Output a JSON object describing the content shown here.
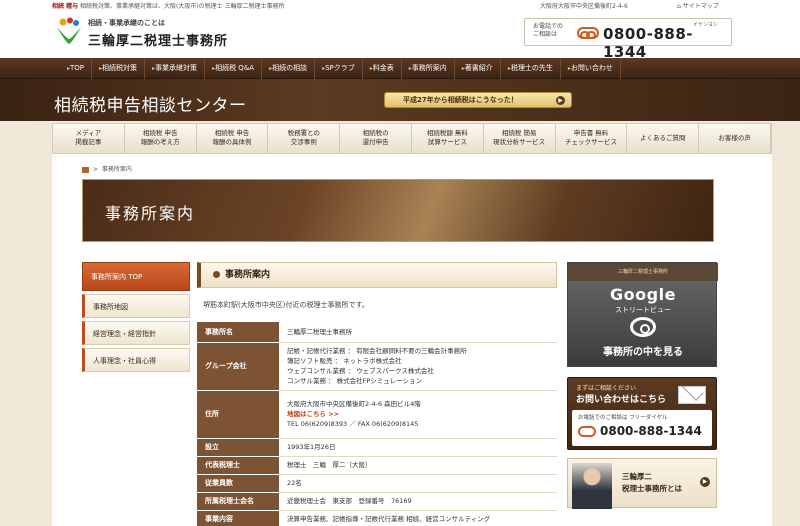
{
  "header": {
    "tagline_lead": "相続 贈与",
    "tagline_rest": " 相続税対策、事業承継対策は、大阪(大阪市)の税理士 三輪厚二税理士事務所",
    "address": "大阪府大阪市中央区備後町2-4-6",
    "sitemap": "サイトマップ",
    "logo_sub": "相続・事業承継のことは",
    "logo_main": "三輪厚二税理士事務所",
    "phone_label_1": "お電話での",
    "phone_label_2": "ご相談は",
    "phone_ruby": "イヤンヨシ",
    "phone": "0800-888-1344"
  },
  "global_nav": [
    "TOP",
    "相続税対策",
    "事業承継対策",
    "相続税 Q&A",
    "相続の相談",
    "SPクラブ",
    "料金表",
    "事務所案内",
    "著書紹介",
    "税理士の先生",
    "お問い合わせ"
  ],
  "banner": {
    "title": "相続税申告相談センター",
    "pill": "平成27年から相続税はこうなった！"
  },
  "sub_nav": [
    {
      "l1": "メディア",
      "l2": "掲載記事"
    },
    {
      "l1": "相続税 申告",
      "l2": "報酬の考え方"
    },
    {
      "l1": "相続税 申告",
      "l2": "報酬の具体例"
    },
    {
      "l1": "税務署との",
      "l2": "交渉事例"
    },
    {
      "l1": "相続税の",
      "l2": "還付申告"
    },
    {
      "l1": "相続税額 無料",
      "l2": "試算サービス"
    },
    {
      "l1": "相続税 簡易",
      "l2": "現状分析サービス"
    },
    {
      "l1": "申告書 無料",
      "l2": "チェックサービス"
    },
    {
      "l1": "よくあるご質問",
      "l2": ""
    },
    {
      "l1": "お客様の声",
      "l2": ""
    }
  ],
  "breadcrumb": {
    "current": "事務所案内"
  },
  "hero": {
    "title": "事務所案内"
  },
  "sidebar": [
    "事務所案内 TOP",
    "事務所地図",
    "経営理念・経営指針",
    "人事理念・社員心得"
  ],
  "main": {
    "heading": "事務所案内",
    "intro": "堺筋本町駅(大阪市中央区)付近の税理士事務所です。",
    "rows": [
      {
        "th": "事務所名",
        "lines": [
          "三輪厚二税理士事務所"
        ]
      },
      {
        "th": "グループ会社",
        "lines": [
          "記帳・記帳代行業務 ： 有限会社顧問料不要の三輪会計事務所",
          "簿記ソフト販売 ： ネットラボ株式会社",
          "ウェブコンサル業務 ： ウェブスパークス株式会社",
          "コンサル業務 ： 株式会社FPシミュレーション"
        ]
      },
      {
        "th": "住所",
        "lines": [
          "大阪府大阪市中央区備後町2-4-6 森田ビル4階",
          "地図はこちら >>",
          "TEL 06(6209)8393 ／ FAX 06(6209)8145"
        ]
      },
      {
        "th": "設立",
        "lines": [
          "1993年1月26日"
        ]
      },
      {
        "th": "代表税理士",
        "lines": [
          "税理士　三輪　厚二（大阪）"
        ]
      },
      {
        "th": "従業員数",
        "lines": [
          "22名"
        ]
      },
      {
        "th": "所属税理士会名",
        "lines": [
          "近畿税理士会　東支部　登録番号　76169"
        ]
      },
      {
        "th": "事業内容",
        "lines": [
          "決算申告業務、記帳指導・記帳代行業務  相続、経営コンサルティング"
        ]
      }
    ]
  },
  "right": {
    "building_sign": "三輪厚二税理士事務所",
    "google": "Google",
    "streetview": "ストリートビュー",
    "see_inside": "事務所の中を見る",
    "contact_l1": "まずはご相談ください",
    "contact_l2": "お問い合わせはこちら",
    "contact_phone_text": "お電話でのご相談は フリーダイヤル",
    "contact_phone": "0800-888-1344",
    "profile_l1": "三輪厚二",
    "profile_l2": "税理士事務所とは"
  }
}
